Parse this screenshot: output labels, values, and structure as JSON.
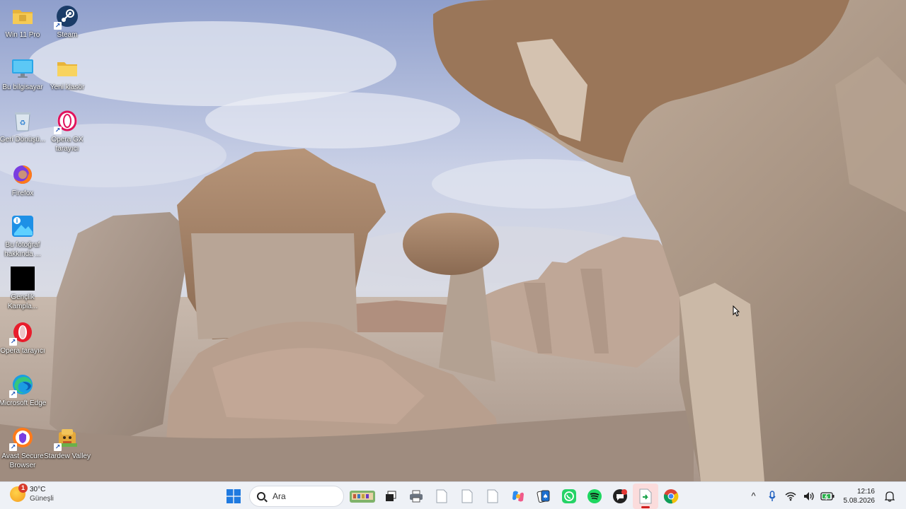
{
  "desktop": {
    "icons": [
      {
        "id": "win11pro",
        "label": "Win 11 Pro",
        "icon": "folder-icon"
      },
      {
        "id": "steam",
        "label": "Steam",
        "icon": "steam-icon"
      },
      {
        "id": "this-pc",
        "label": "Bu bilgisayar",
        "icon": "monitor-icon"
      },
      {
        "id": "new-folder",
        "label": "Yeni klasör",
        "icon": "folder-icon"
      },
      {
        "id": "recycle-bin",
        "label": "Geri Dönüşü...",
        "icon": "recycle-bin-icon"
      },
      {
        "id": "opera-gx",
        "label": "Opera GX tarayıcı",
        "icon": "opera-gx-icon"
      },
      {
        "id": "firefox",
        "label": "Firefox",
        "icon": "firefox-icon"
      },
      {
        "id": "about-photo",
        "label": "Bu fotoğraf hakkında ...",
        "icon": "photo-info-icon"
      },
      {
        "id": "youth-camp",
        "label": "Gençlik Kampla...",
        "icon": "black-square-icon"
      },
      {
        "id": "opera",
        "label": "Opera tarayıcı",
        "icon": "opera-icon"
      },
      {
        "id": "edge",
        "label": "Microsoft Edge",
        "icon": "edge-icon"
      },
      {
        "id": "avast",
        "label": "Avast Secure Browser",
        "icon": "avast-icon"
      },
      {
        "id": "stardew",
        "label": "Stardew Valley",
        "icon": "stardew-icon"
      }
    ]
  },
  "taskbar": {
    "weather": {
      "temp": "30°C",
      "condition": "Güneşli",
      "badge": "1"
    },
    "search": {
      "placeholder": "Ara"
    },
    "clock": {
      "time": "12:16",
      "date": "5.08.2026"
    },
    "tray_overflow": "^"
  },
  "colors": {
    "taskbar_bg": "#eef1f6",
    "active_app_indicator": "#d11f1f",
    "windows_blue": "#1f7ae0"
  }
}
